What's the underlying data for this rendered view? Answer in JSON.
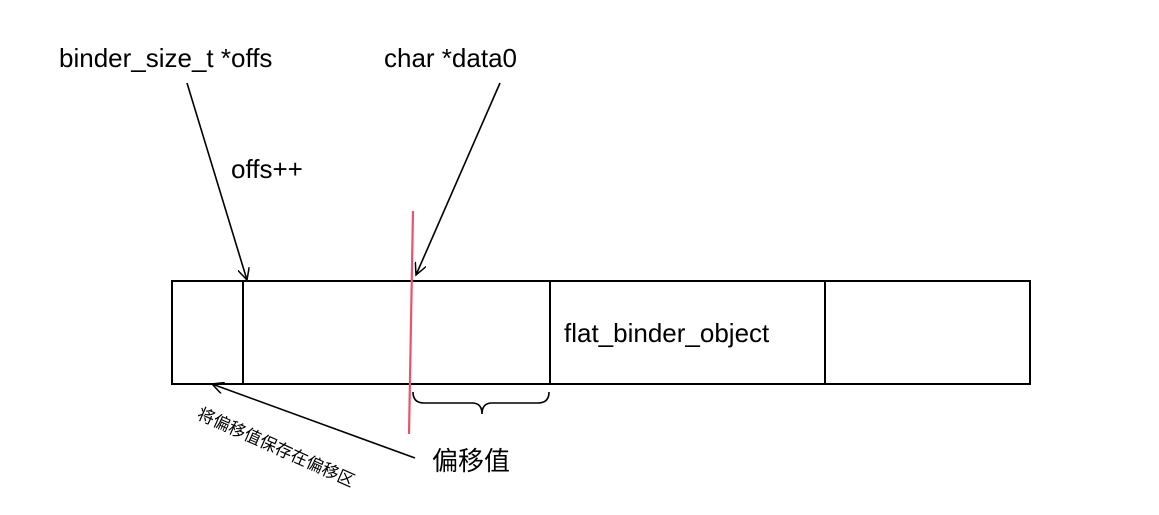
{
  "labels": {
    "offs_pointer": "binder_size_t *offs",
    "data_pointer": "char *data0",
    "offs_increment": "offs++",
    "flat_object": "flat_binder_object",
    "offset_value": "偏移值",
    "save_note": "将偏移值保存在偏移区"
  },
  "colors": {
    "stroke": "#000000",
    "cursor_line": "#e8556a"
  }
}
